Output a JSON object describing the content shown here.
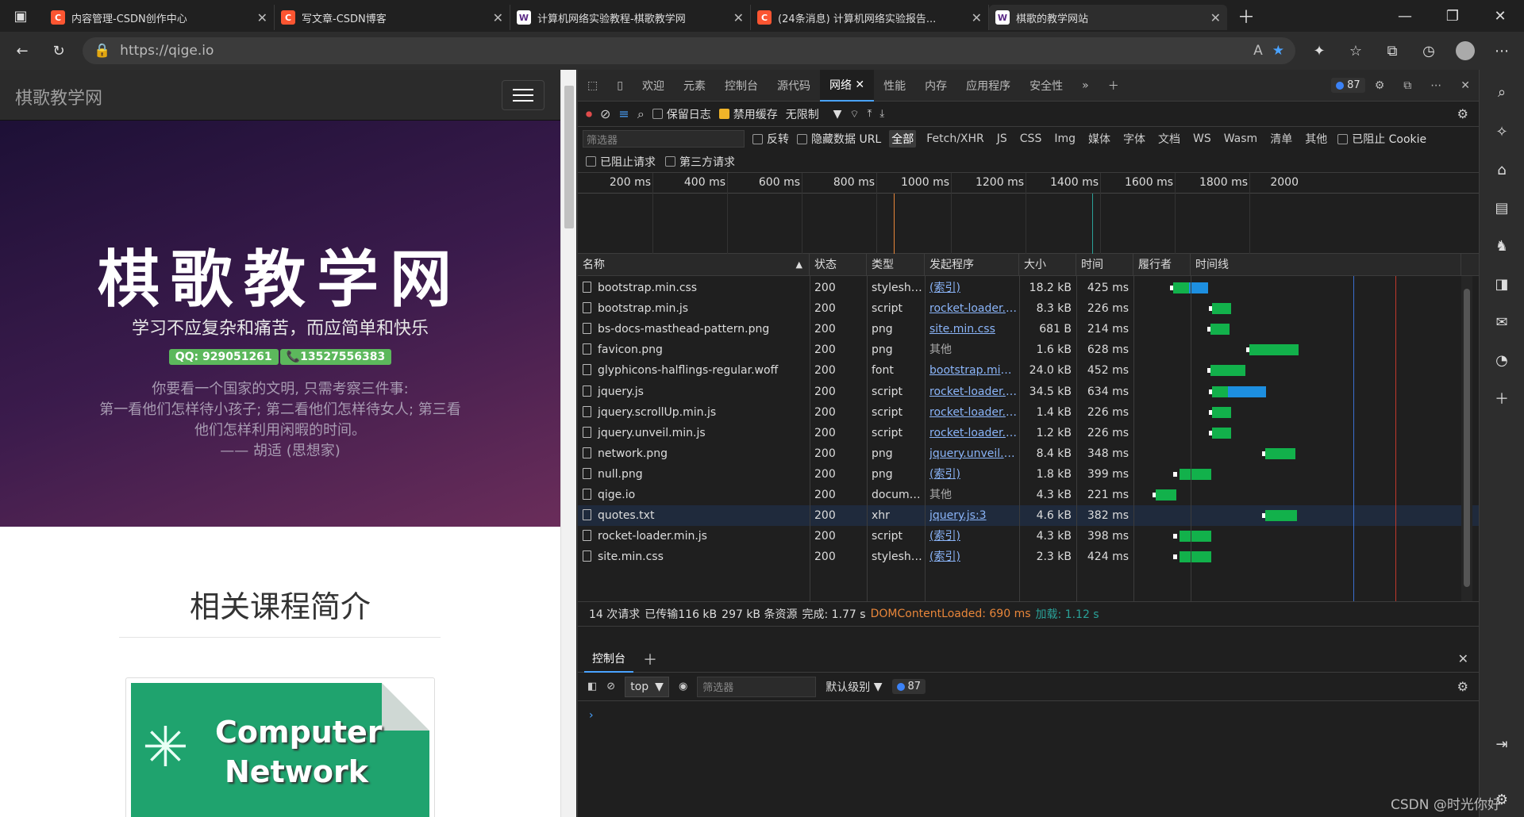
{
  "tabs": [
    {
      "icon": "C",
      "title": "内容管理-CSDN创作中心"
    },
    {
      "icon": "C",
      "title": "写文章-CSDN博客"
    },
    {
      "icon": "W",
      "title": "计算机网络实验教程-棋歌教学网"
    },
    {
      "icon": "C",
      "title": "(24条消息) 计算机网络实验报告..."
    },
    {
      "icon": "W",
      "title": "棋歌的教学网站"
    }
  ],
  "address": {
    "url": "https://qige.io"
  },
  "page": {
    "brand": "棋歌教学网",
    "hero_title": "棋歌教学网",
    "hero_sub": "学习不应复杂和痛苦，而应简单和快乐",
    "qq": "QQ: 929051261",
    "phone": "📞13527556383",
    "quote1": "你要看一个国家的文明, 只需考察三件事:",
    "quote2": "第一看他们怎样待小孩子; 第二看他们怎样待女人; 第三看",
    "quote3": "他们怎样利用闲暇的时间。",
    "quote4": "—— 胡适 (思想家)",
    "section_title": "相关课程简介",
    "card_line1": "Computer",
    "card_line2": "Network"
  },
  "devtools": {
    "tabs": [
      "欢迎",
      "元素",
      "控制台",
      "源代码",
      "网络",
      "性能",
      "内存",
      "应用程序",
      "安全性"
    ],
    "issues": "87",
    "toolbar": {
      "preserve_log": "保留日志",
      "disable_cache": "禁用缓存",
      "throttle": "无限制"
    },
    "filter": {
      "placeholder": "筛选器",
      "invert": "反转",
      "hide_data": "隐藏数据 URL",
      "types": [
        "全部",
        "Fetch/XHR",
        "JS",
        "CSS",
        "Img",
        "媒体",
        "字体",
        "文档",
        "WS",
        "Wasm",
        "清单",
        "其他"
      ],
      "blocked_cookies": "已阻止 Cookie",
      "blocked_requests": "已阻止请求",
      "third_party": "第三方请求"
    },
    "ruler": [
      "200 ms",
      "400 ms",
      "600 ms",
      "800 ms",
      "1000 ms",
      "1200 ms",
      "1400 ms",
      "1600 ms",
      "1800 ms",
      "2000"
    ],
    "columns": [
      "名称",
      "状态",
      "类型",
      "发起程序",
      "大小",
      "时间",
      "履行者",
      "时间线"
    ],
    "rows": [
      {
        "name": "bootstrap.min.css",
        "status": "200",
        "type": "stylesheet",
        "initiator": "(索引)",
        "size": "18.2 kB",
        "time": "425 ms"
      },
      {
        "name": "bootstrap.min.js",
        "status": "200",
        "type": "script",
        "initiator": "rocket-loader.min....",
        "size": "8.3 kB",
        "time": "226 ms"
      },
      {
        "name": "bs-docs-masthead-pattern.png",
        "status": "200",
        "type": "png",
        "initiator": "site.min.css",
        "size": "681 B",
        "time": "214 ms"
      },
      {
        "name": "favicon.png",
        "status": "200",
        "type": "png",
        "initiator": "其他",
        "size": "1.6 kB",
        "time": "628 ms"
      },
      {
        "name": "glyphicons-halflings-regular.woff",
        "status": "200",
        "type": "font",
        "initiator": "bootstrap.min.css",
        "size": "24.0 kB",
        "time": "452 ms"
      },
      {
        "name": "jquery.js",
        "status": "200",
        "type": "script",
        "initiator": "rocket-loader.min....",
        "size": "34.5 kB",
        "time": "634 ms"
      },
      {
        "name": "jquery.scrollUp.min.js",
        "status": "200",
        "type": "script",
        "initiator": "rocket-loader.min....",
        "size": "1.4 kB",
        "time": "226 ms"
      },
      {
        "name": "jquery.unveil.min.js",
        "status": "200",
        "type": "script",
        "initiator": "rocket-loader.min....",
        "size": "1.2 kB",
        "time": "226 ms"
      },
      {
        "name": "network.png",
        "status": "200",
        "type": "png",
        "initiator": "jquery.unveil.min.j...",
        "size": "8.4 kB",
        "time": "348 ms"
      },
      {
        "name": "null.png",
        "status": "200",
        "type": "png",
        "initiator": "(索引)",
        "size": "1.8 kB",
        "time": "399 ms"
      },
      {
        "name": "qige.io",
        "status": "200",
        "type": "document",
        "initiator": "其他",
        "size": "4.3 kB",
        "time": "221 ms"
      },
      {
        "name": "quotes.txt",
        "status": "200",
        "type": "xhr",
        "initiator": "jquery.js:3",
        "size": "4.6 kB",
        "time": "382 ms"
      },
      {
        "name": "rocket-loader.min.js",
        "status": "200",
        "type": "script",
        "initiator": "(索引)",
        "size": "4.3 kB",
        "time": "398 ms"
      },
      {
        "name": "site.min.css",
        "status": "200",
        "type": "stylesheet",
        "initiator": "(索引)",
        "size": "2.3 kB",
        "time": "424 ms"
      }
    ],
    "status": {
      "requests": "14 次请求",
      "transferred": "已传输116 kB",
      "resources": "297 kB 条资源",
      "finish": "完成: 1.77 s",
      "dom": "DOMContentLoaded: 690 ms",
      "load": "加载: 1.12 s"
    },
    "drawer": {
      "console_tab": "控制台",
      "context": "top",
      "filter_placeholder": "筛选器",
      "level": "默认级别",
      "issues": "87"
    }
  },
  "watermark": "CSDN @时光你好"
}
